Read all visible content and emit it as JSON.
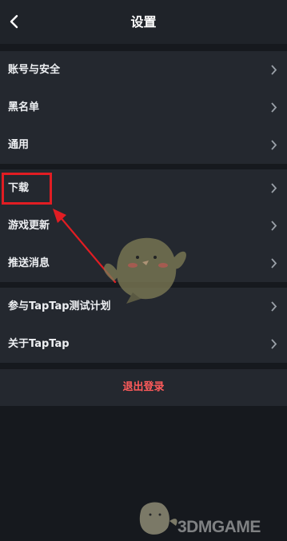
{
  "header": {
    "title": "设置"
  },
  "groups": [
    {
      "items": [
        {
          "label": "账号与安全"
        },
        {
          "label": "黑名单"
        },
        {
          "label": "通用"
        }
      ]
    },
    {
      "items": [
        {
          "label": "下载"
        },
        {
          "label": "游戏更新"
        },
        {
          "label": "推送消息"
        }
      ]
    },
    {
      "items": [
        {
          "label": "参与TapTap测试计划"
        },
        {
          "label": "关于TapTap"
        }
      ]
    }
  ],
  "logout": {
    "label": "退出登录"
  },
  "annotation": {
    "box_color": "#e11d23",
    "arrow_color": "#e11d23"
  },
  "watermark": {
    "text": "3DMGAME"
  },
  "colors": {
    "background": "#16191e",
    "header": "#1f2329",
    "row": "#24282f",
    "logout_text": "#ff5b5b"
  }
}
